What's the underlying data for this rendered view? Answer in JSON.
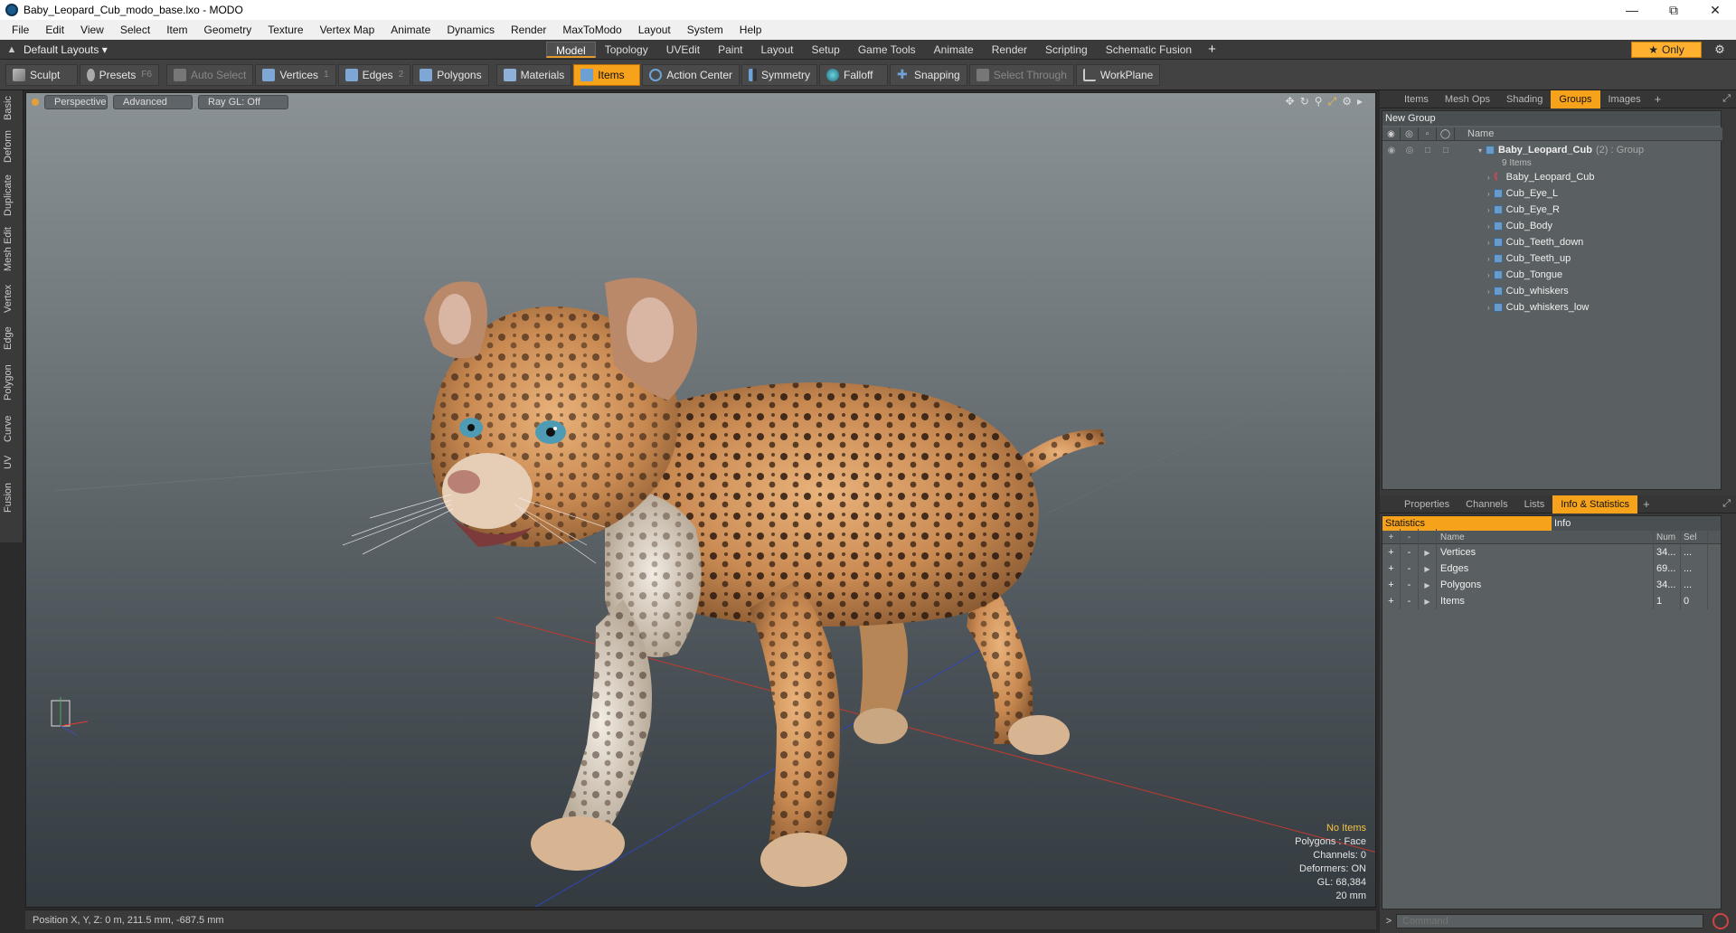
{
  "window": {
    "title": "Baby_Leopard_Cub_modo_base.lxo - MODO",
    "minimize": "—",
    "maximize": "⧉",
    "close": "✕"
  },
  "menu": [
    "File",
    "Edit",
    "View",
    "Select",
    "Item",
    "Geometry",
    "Texture",
    "Vertex Map",
    "Animate",
    "Dynamics",
    "Render",
    "MaxToModo",
    "Layout",
    "System",
    "Help"
  ],
  "layoutbar": {
    "layout_name": "Default Layouts ▾",
    "tabs": [
      "Model",
      "Topology",
      "UVEdit",
      "Paint",
      "Layout",
      "Setup",
      "Game Tools",
      "Animate",
      "Render",
      "Scripting",
      "Schematic Fusion"
    ],
    "active_tab": "Model",
    "add": "+",
    "only_label": "Only",
    "star": "★"
  },
  "toolbar": {
    "sculpt": "Sculpt",
    "presets": "Presets",
    "presets_key": "F6",
    "auto_select": "Auto Select",
    "vertices": "Vertices",
    "vertices_key": "1",
    "edges": "Edges",
    "edges_key": "2",
    "polygons": "Polygons",
    "materials": "Materials",
    "items": "Items",
    "action_center": "Action Center",
    "symmetry": "Symmetry",
    "falloff": "Falloff",
    "snapping": "Snapping",
    "select_through": "Select Through",
    "workplane": "WorkPlane"
  },
  "left_tabs": [
    "Basic",
    "Deform",
    "Duplicate",
    "Mesh Edit",
    "Vertex",
    "Edge",
    "Polygon",
    "Curve",
    "UV",
    "Fusion"
  ],
  "viewport": {
    "view_mode": "Perspective",
    "shading": "Advanced",
    "raygl": "Ray GL: Off",
    "info": {
      "selection": "No Items",
      "polygons": "Polygons : Face",
      "channels": "Channels: 0",
      "deformers": "Deformers: ON",
      "gl": "GL: 68,384",
      "scale": "20 mm"
    }
  },
  "status": "Position X, Y, Z:  0 m, 211.5 mm, -687.5 mm",
  "top_panel": {
    "tabs": [
      "Items",
      "Mesh Ops",
      "Shading",
      "Groups",
      "Images"
    ],
    "active": "Groups",
    "new_group": "New Group",
    "name_col": "Name",
    "group": {
      "name": "Baby_Leopard_Cub",
      "count": "(2)",
      "type": ": Group",
      "items_count": "9 Items"
    },
    "children": [
      "Baby_Leopard_Cub",
      "Cub_Eye_L",
      "Cub_Eye_R",
      "Cub_Body",
      "Cub_Teeth_down",
      "Cub_Teeth_up",
      "Cub_Tongue",
      "Cub_whiskers",
      "Cub_whiskers_low"
    ]
  },
  "bottom_panel": {
    "tabs": [
      "Properties",
      "Channels",
      "Lists",
      "Info & Statistics"
    ],
    "active": "Info & Statistics",
    "subtabs": [
      "Statistics",
      "Info"
    ],
    "columns": {
      "name": "Name",
      "num": "Num",
      "sel": "Sel"
    },
    "rows": [
      {
        "name": "Vertices",
        "num": "34...",
        "sel": "..."
      },
      {
        "name": "Edges",
        "num": "69...",
        "sel": "..."
      },
      {
        "name": "Polygons",
        "num": "34...",
        "sel": "..."
      },
      {
        "name": "Items",
        "num": "1",
        "sel": "0"
      }
    ]
  },
  "command": {
    "placeholder": "Command",
    "prompt": ">"
  },
  "colors": {
    "accent": "#f7a21b",
    "viewport_top": "#8b9296",
    "viewport_bottom": "#333b40"
  }
}
